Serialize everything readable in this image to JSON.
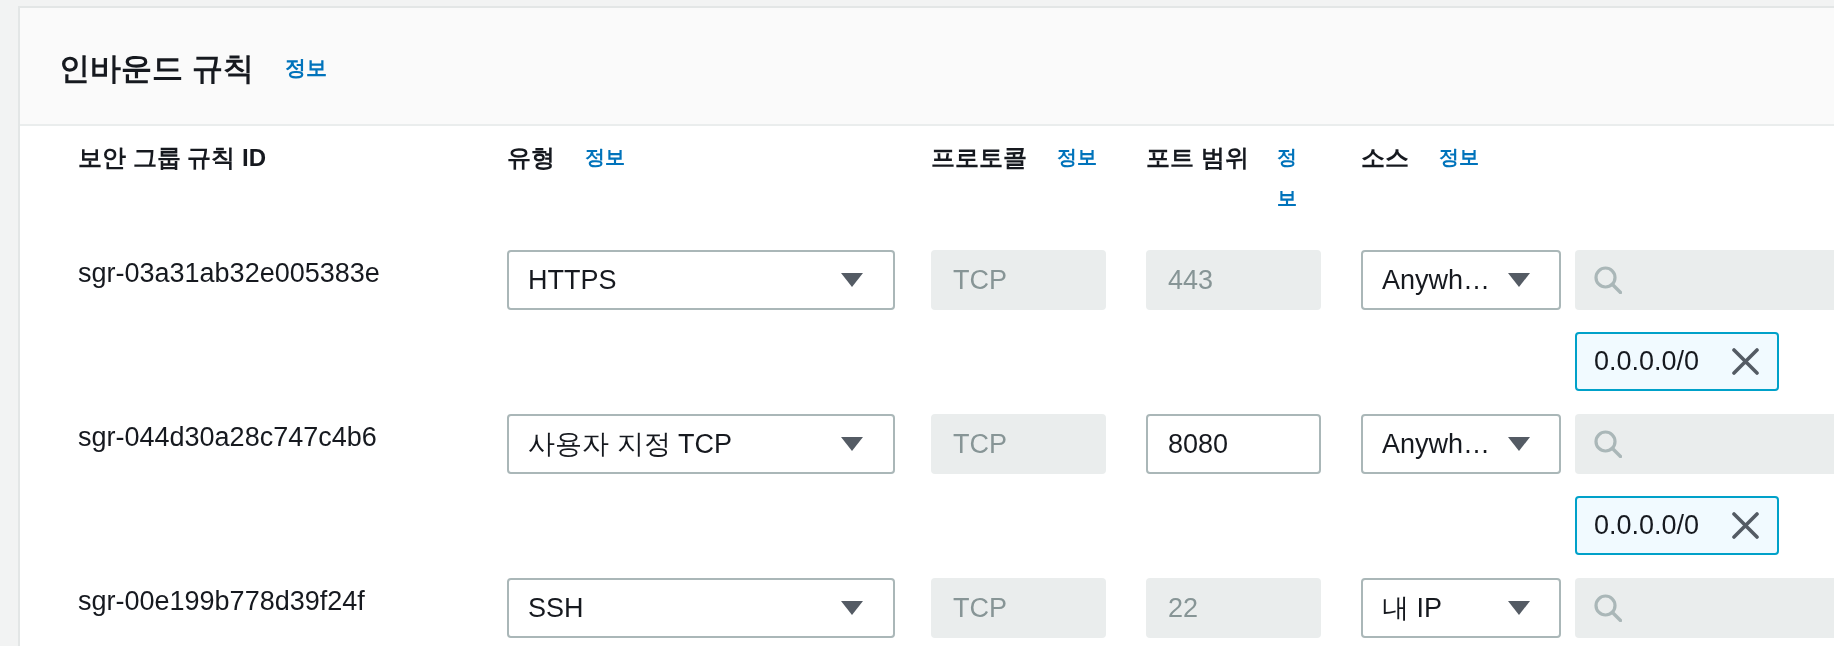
{
  "panel": {
    "title": "인바운드 규칙",
    "info_link": "정보"
  },
  "columns": [
    {
      "label": "보안 그룹 규칙 ID"
    },
    {
      "label": "유형",
      "info_link": "정보"
    },
    {
      "label": "프로토콜",
      "info_link": "정보"
    },
    {
      "label": "포트 범위",
      "info_link": "정보"
    },
    {
      "label": "소스",
      "info_link": "정보"
    }
  ],
  "rules": [
    {
      "id": "sgr-03a31ab32e005383e",
      "type": "HTTPS",
      "protocol": {
        "value": "TCP",
        "disabled": true
      },
      "port_range": {
        "value": "443",
        "disabled": true
      },
      "source": "Anywh…",
      "source_search": {
        "disabled": true
      },
      "cidr_blocks": [
        {
          "label": "0.0.0.0/0"
        }
      ]
    },
    {
      "id": "sgr-044d30a28c747c4b6",
      "type": "사용자 지정 TCP",
      "protocol": {
        "value": "TCP",
        "disabled": true
      },
      "port_range": {
        "value": "8080",
        "disabled": false
      },
      "source": "Anywh…",
      "source_search": {
        "disabled": true
      },
      "cidr_blocks": [
        {
          "label": "0.0.0.0/0"
        }
      ]
    },
    {
      "id": "sgr-00e199b778d39f24f",
      "type": "SSH",
      "protocol": {
        "value": "TCP",
        "disabled": true
      },
      "port_range": {
        "value": "22",
        "disabled": true
      },
      "source": "내 IP",
      "source_search": {
        "disabled": true
      }
    }
  ]
}
